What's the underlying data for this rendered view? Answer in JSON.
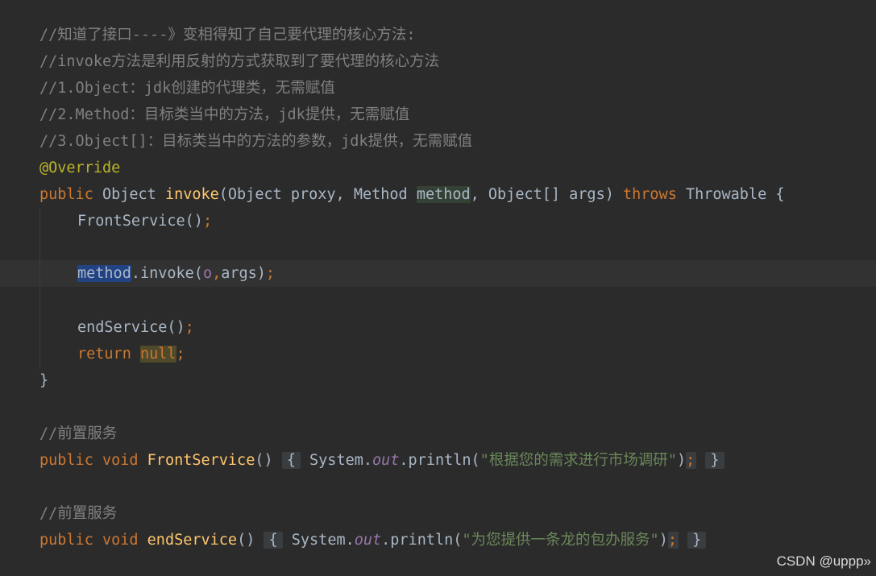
{
  "code": {
    "comments": [
      "//知道了接口----》变相得知了自己要代理的核心方法:",
      "//invoke方法是利用反射的方式获取到了要代理的核心方法",
      "//1.Object：jdk创建的代理类，无需赋值",
      "//2.Method：目标类当中的方法，jdk提供，无需赋值",
      "//3.Object[]：目标类当中的方法的参数，jdk提供，无需赋值"
    ],
    "annotation": "@Override",
    "sig": {
      "kw_public": "public",
      "ret_type": " Object ",
      "name": "invoke",
      "params_a": "(Object proxy, Method ",
      "param_method": "method",
      "params_b": ", Object[] args) ",
      "kw_throws": "throws",
      "tail": " Throwable {"
    },
    "front_call": {
      "name": "FrontService()",
      "semi": ";"
    },
    "invoke_line": {
      "selected": "method",
      "rest": ".invoke(",
      "arg_o": "o",
      "comma": ",",
      "args": "args",
      "close": ")",
      "semi": ";"
    },
    "end_call": {
      "name": "endService()",
      "semi": ";"
    },
    "return_line": {
      "kw": "return",
      "val": "null",
      "semi": ";"
    },
    "close_brace": "}",
    "comment_front": "//前置服务",
    "front_method": {
      "kw_public": "public",
      "kw_void": "void",
      "name": "FrontService",
      "parens": "()",
      "open": "{",
      "sys": " System.",
      "out": "out",
      "println": ".println(",
      "str": "\"根据您的需求进行市场调研\"",
      "close_paren": ")",
      "semi": ";",
      "close": "}"
    },
    "comment_end": "//前置服务",
    "end_method": {
      "kw_public": "public",
      "kw_void": "void",
      "name": "endService",
      "parens": "()",
      "open": "{",
      "sys": " System.",
      "out": "out",
      "println": ".println(",
      "str": "\"为您提供一条龙的包办服务\"",
      "close_paren": ")",
      "semi": ";",
      "close": "}"
    }
  },
  "watermark": "CSDN @uppp»",
  "colors": {
    "background": "#2b2b2b",
    "comment": "#808080",
    "keyword": "#cc7832",
    "function": "#ffc66d",
    "string": "#6a8759",
    "annotation": "#bbb529",
    "static_field": "#9876aa",
    "selection": "#214283"
  }
}
